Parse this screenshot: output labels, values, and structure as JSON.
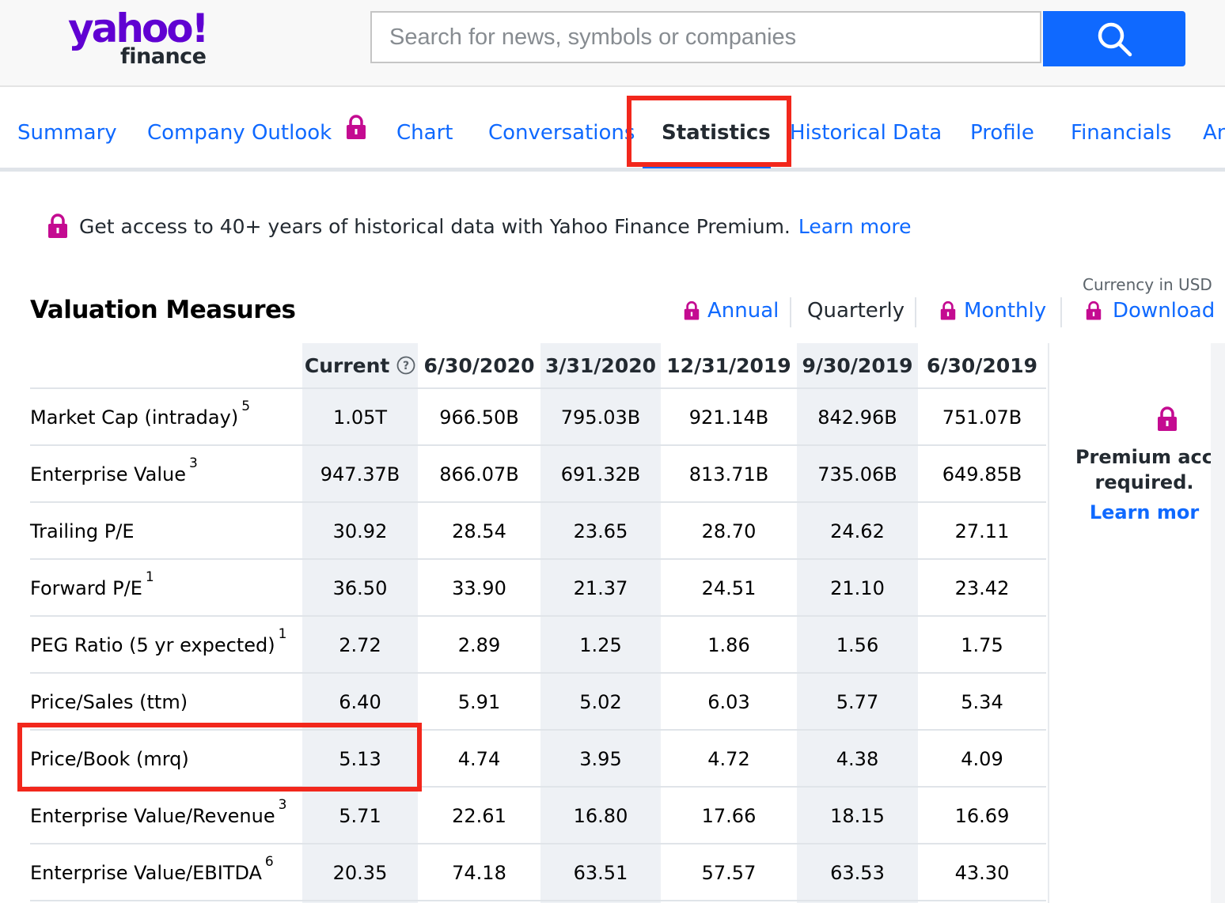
{
  "header": {
    "logo_yahoo": "yahoo!",
    "logo_finance": "finance",
    "search_placeholder": "Search for news, symbols or companies",
    "search_icon": "search-icon",
    "brand_color": "#6001d2",
    "accent_color": "#0f69ff"
  },
  "tabs": [
    {
      "label": "Summary"
    },
    {
      "label": "Company Outlook"
    },
    {
      "label": "Chart"
    },
    {
      "label": "Conversations"
    },
    {
      "label": "Statistics"
    },
    {
      "label": "Historical Data"
    },
    {
      "label": "Profile"
    },
    {
      "label": "Financials"
    },
    {
      "label": "An"
    }
  ],
  "active_tab": "Statistics",
  "premium_banner": {
    "text": "Get access to 40+ years of historical data with Yahoo Finance Premium.",
    "link": "Learn more"
  },
  "section": {
    "title": "Valuation Measures",
    "currency": "Currency in USD",
    "periods": {
      "annual": "Annual",
      "quarterly": "Quarterly",
      "monthly": "Monthly",
      "download": "Download"
    }
  },
  "table": {
    "columns": [
      "Current",
      "6/30/2020",
      "3/31/2020",
      "12/31/2019",
      "9/30/2019",
      "6/30/2019"
    ],
    "rows": [
      {
        "label": "Market Cap (intraday)",
        "note": "5",
        "values": [
          "1.05T",
          "966.50B",
          "795.03B",
          "921.14B",
          "842.96B",
          "751.07B"
        ]
      },
      {
        "label": "Enterprise Value",
        "note": "3",
        "values": [
          "947.37B",
          "866.07B",
          "691.32B",
          "813.71B",
          "735.06B",
          "649.85B"
        ]
      },
      {
        "label": "Trailing P/E",
        "note": "",
        "values": [
          "30.92",
          "28.54",
          "23.65",
          "28.70",
          "24.62",
          "27.11"
        ]
      },
      {
        "label": "Forward P/E",
        "note": "1",
        "values": [
          "36.50",
          "33.90",
          "21.37",
          "24.51",
          "21.10",
          "23.42"
        ]
      },
      {
        "label": "PEG Ratio (5 yr expected)",
        "note": "1",
        "values": [
          "2.72",
          "2.89",
          "1.25",
          "1.86",
          "1.56",
          "1.75"
        ]
      },
      {
        "label": "Price/Sales (ttm)",
        "note": "",
        "values": [
          "6.40",
          "5.91",
          "5.02",
          "6.03",
          "5.77",
          "5.34"
        ]
      },
      {
        "label": "Price/Book (mrq)",
        "note": "",
        "values": [
          "5.13",
          "4.74",
          "3.95",
          "4.72",
          "4.38",
          "4.09"
        ]
      },
      {
        "label": "Enterprise Value/Revenue",
        "note": "3",
        "values": [
          "5.71",
          "22.61",
          "16.80",
          "17.66",
          "18.15",
          "16.69"
        ]
      },
      {
        "label": "Enterprise Value/EBITDA",
        "note": "6",
        "values": [
          "20.35",
          "74.18",
          "63.51",
          "57.57",
          "63.53",
          "43.30"
        ]
      }
    ]
  },
  "premium_panel": {
    "line1": "Premium acc",
    "line2": "required.",
    "link": "Learn mor"
  },
  "highlight_color": "#f2271c",
  "lock_color": "#c40b91"
}
